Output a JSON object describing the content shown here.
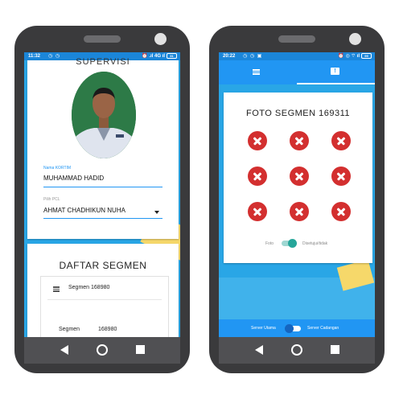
{
  "left_phone": {
    "status": {
      "time": "11:32",
      "icons_left": "◷ ◷",
      "icons_right": "⏰ .ıl 4G ıl",
      "battery": "31"
    },
    "profile": {
      "heading_cut": "SUPERVISI",
      "kortim_label": "Nama KORTIM",
      "kortim_value": "MUHAMMAD HADID",
      "pcl_label": "Pilih PCL",
      "pcl_value": "AHMAT CHADHIKUN NUHA"
    },
    "segments": {
      "title": "DAFTAR SEGMEN",
      "header": "Segmen 168980",
      "row_label": "Segmen",
      "row_value": "168980"
    }
  },
  "right_phone": {
    "status": {
      "time": "20:22",
      "icons_left": "◷ ◷ ▣",
      "icons_right": "⏰ ◎ ⌔ ıl",
      "battery": "99"
    },
    "tabs": [
      {
        "icon": "list-icon",
        "selected": false
      },
      {
        "icon": "message-icon",
        "selected": true,
        "glyph": "!"
      }
    ],
    "photo_card": {
      "title": "FOTO SEGMEN 169311",
      "tiles": [
        "close",
        "close",
        "close",
        "close",
        "close",
        "close",
        "close",
        "close",
        "close"
      ],
      "switch_left": "Foto",
      "switch_right": "Disetujui/tidak",
      "switch_on": true
    },
    "bottom": {
      "left": "Server Utama",
      "right": "Server Cadangan",
      "switch_on": true
    }
  },
  "colors": {
    "primary": "#2196f3",
    "status": "#1b86d9",
    "accent_toggle": "#26a69a",
    "error": "#d32f2f",
    "frame": "#3a3a3c"
  }
}
